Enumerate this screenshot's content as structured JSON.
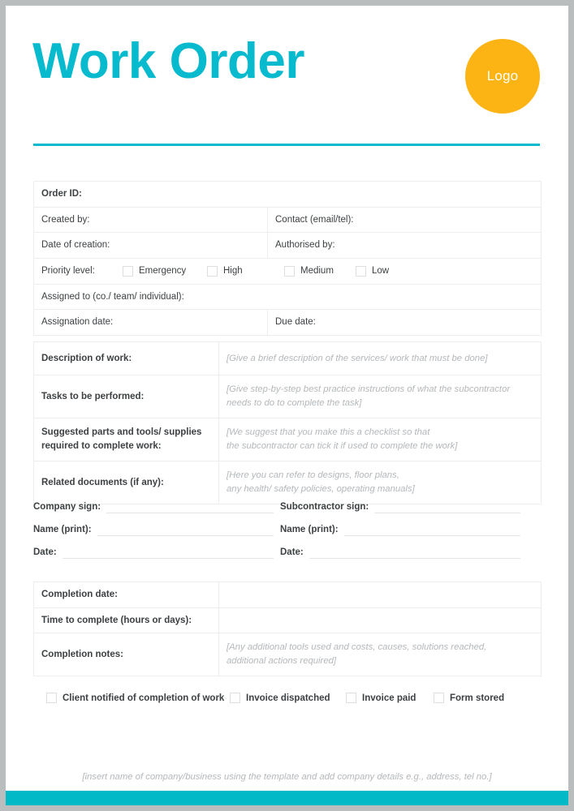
{
  "colors": {
    "accent_cyan": "#08bacd",
    "footer_bar": "#02b9c8",
    "logo_orange": "#fcb414",
    "text": "#3d4143",
    "placeholder": "#b4b8bb",
    "border": "#eceded"
  },
  "header": {
    "title": "Work Order",
    "logo_text": "Logo"
  },
  "details_table": {
    "order_id_label": "Order ID:",
    "created_by_label": "Created by:",
    "contact_label": "Contact (email/tel):",
    "date_of_creation_label": "Date of creation:",
    "authorised_by_label": "Authorised by:",
    "priority_label": "Priority level:",
    "priority_options": [
      "Emergency",
      "High",
      "Medium",
      "Low"
    ],
    "assigned_to_label": "Assigned to (co./ team/ individual):",
    "assignation_date_label": "Assignation date:",
    "due_date_label": "Due date:"
  },
  "work_table": {
    "rows": [
      {
        "label": "Description of work:",
        "placeholder": "[Give a brief description of the services/ work that must be done]"
      },
      {
        "label": "Tasks to be performed:",
        "placeholder": "[Give step-by-step best practice instructions of what the subcontractor\nneeds to do to complete the task]"
      },
      {
        "label": "Suggested parts and tools/ supplies\nrequired to complete work:",
        "placeholder": "[We suggest that you make this a checklist so that\nthe subcontractor can tick it if used to complete the work]"
      },
      {
        "label": "Related documents (if any):",
        "placeholder": "[Here you can refer to designs, floor plans,\nany health/ safety policies, operating manuals]"
      }
    ]
  },
  "signatures": {
    "company": {
      "sign_label": "Company sign:",
      "name_label": "Name (print):",
      "date_label": "Date:"
    },
    "subcontractor": {
      "sign_label": "Subcontractor sign:",
      "name_label": "Name (print):",
      "date_label": "Date:"
    }
  },
  "completion_table": {
    "completion_date_label": "Completion date:",
    "time_to_complete_label": "Time to complete (hours or days):",
    "completion_notes_label": "Completion notes:",
    "completion_notes_placeholder": "[Any additional tools used and costs, causes, solutions reached,\nadditional actions required]"
  },
  "final_checks": [
    "Client notified of completion of work",
    "Invoice dispatched",
    "Invoice paid",
    "Form stored"
  ],
  "footer": {
    "note": "[insert name of company/business using the template and add company details e.g., address, tel no.]"
  }
}
